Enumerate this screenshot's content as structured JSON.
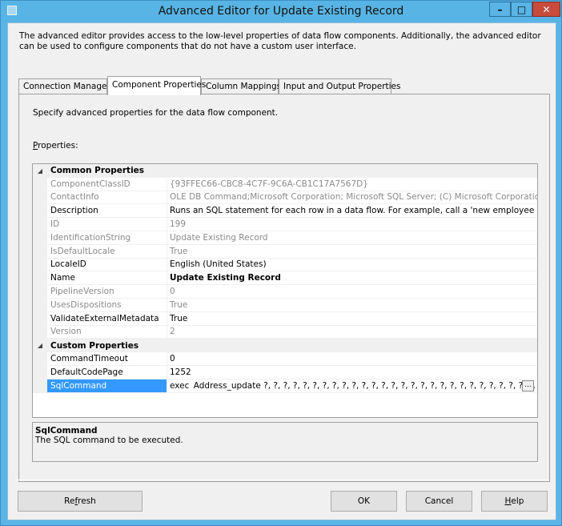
{
  "window": {
    "title": "Advanced Editor for Update Existing Record",
    "min_glyph": "–",
    "max_glyph": "□",
    "close_glyph": "✕"
  },
  "intro_text": "The advanced editor provides access to the low-level properties of data flow components. Additionally, the advanced editor can be used to configure components that do not have a custom user interface.",
  "tabs": [
    {
      "label": "Connection Managers",
      "active": false
    },
    {
      "label": "Component Properties",
      "active": true
    },
    {
      "label": "Column Mappings",
      "active": false
    },
    {
      "label": "Input and Output Properties",
      "active": false
    }
  ],
  "panel": {
    "description": "Specify advanced properties for the data flow component.",
    "properties_label_accel": "P",
    "properties_label_rest": "roperties:"
  },
  "grid": {
    "toggle_glyph": "◢",
    "categories": [
      {
        "name": "Common Properties",
        "rows": [
          {
            "name": "ComponentClassID",
            "value": "{93FFEC66-CBC8-4C7F-9C6A-CB1C17A7567D}",
            "readonly": true
          },
          {
            "name": "ContactInfo",
            "value": "OLE DB Command;Microsoft Corporation; Microsoft SQL Server; (C) Microsoft Corporation; All Righ",
            "readonly": true
          },
          {
            "name": "Description",
            "value": "Runs an SQL statement for each row in a data flow. For example, call a 'new employee setup' stored",
            "readonly": false
          },
          {
            "name": "ID",
            "value": "199",
            "readonly": true
          },
          {
            "name": "IdentificationString",
            "value": "Update Existing Record",
            "readonly": true
          },
          {
            "name": "IsDefaultLocale",
            "value": "True",
            "readonly": true
          },
          {
            "name": "LocaleID",
            "value": "English (United States)",
            "readonly": false
          },
          {
            "name": "Name",
            "value": "Update Existing Record",
            "readonly": false,
            "bold": true
          },
          {
            "name": "PipelineVersion",
            "value": "0",
            "readonly": true
          },
          {
            "name": "UsesDispositions",
            "value": "True",
            "readonly": true
          },
          {
            "name": "ValidateExternalMetadata",
            "value": "True",
            "readonly": false
          },
          {
            "name": "Version",
            "value": "2",
            "readonly": true
          }
        ]
      },
      {
        "name": "Custom Properties",
        "rows": [
          {
            "name": "CommandTimeout",
            "value": "0",
            "readonly": false
          },
          {
            "name": "DefaultCodePage",
            "value": "1252",
            "readonly": false
          }
        ]
      }
    ],
    "selected_row": {
      "name": "SqlCommand",
      "value_before_caret": "exec ",
      "value_after_caret": "Address_update ?, ?, ?, ?, ?, ?, ?, ?, ?, ?, ?, ?, ?, ?, ?, ?, ?, ?, ?, ?, ?, ?, ?, ?, ?, ?, ?, ?, ?",
      "ellipsis_label": "..."
    }
  },
  "help": {
    "title": "SqlCommand",
    "text": "The SQL command to be executed."
  },
  "buttons": {
    "refresh_pre": "Re",
    "refresh_accel": "f",
    "refresh_post": "resh",
    "ok": "OK",
    "cancel": "Cancel",
    "help_accel": "H",
    "help_post": "elp"
  }
}
